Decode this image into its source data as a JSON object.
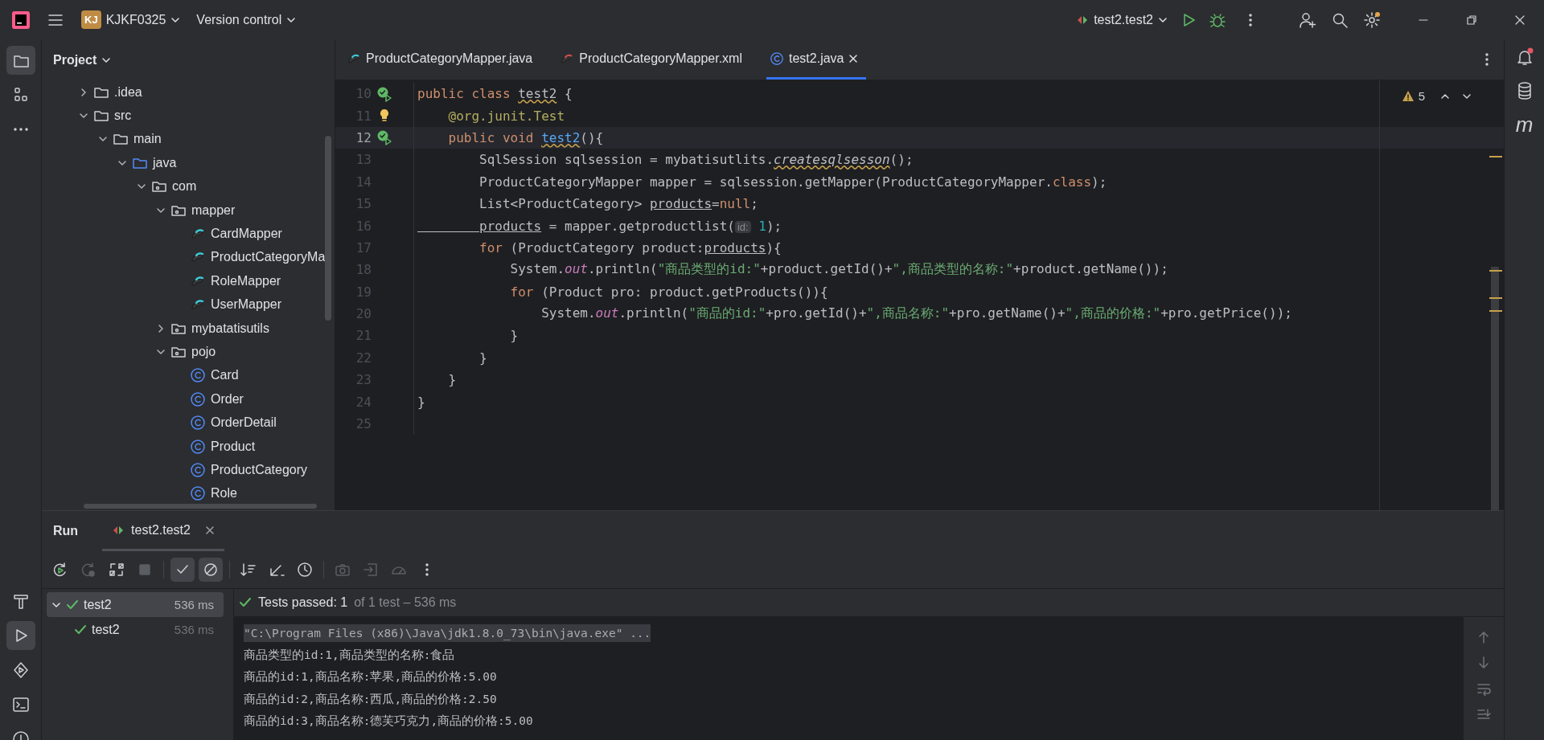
{
  "title_bar": {
    "project_badge": "KJ",
    "project": "KJKF0325",
    "vcs": "Version control",
    "run_config": "test2.test2"
  },
  "left_stripe": {
    "top": [
      {
        "kind": "folder",
        "selected": true
      },
      {
        "kind": "structure",
        "selected": false
      },
      {
        "kind": "more",
        "selected": false
      }
    ],
    "bottom": [
      {
        "kind": "build",
        "selected": false
      },
      {
        "kind": "run",
        "selected": true
      },
      {
        "kind": "services",
        "selected": false
      },
      {
        "kind": "terminal",
        "selected": false
      },
      {
        "kind": "problems",
        "selected": false
      }
    ]
  },
  "project_panel": {
    "title": "Project",
    "tree": [
      {
        "name": ".idea",
        "kind": "folder",
        "expanded": false
      },
      {
        "name": "src",
        "kind": "folder",
        "expanded": true,
        "children": [
          {
            "name": "main",
            "kind": "folder",
            "expanded": true,
            "children": [
              {
                "name": "java",
                "kind": "source",
                "expanded": true,
                "children": [
                  {
                    "name": "com",
                    "kind": "package",
                    "expanded": true,
                    "children": [
                      {
                        "name": "mapper",
                        "kind": "package",
                        "expanded": true,
                        "children": [
                          {
                            "name": "CardMapper",
                            "kind": "mapper"
                          },
                          {
                            "name": "ProductCategoryMa",
                            "kind": "mapper"
                          },
                          {
                            "name": "RoleMapper",
                            "kind": "mapper"
                          },
                          {
                            "name": "UserMapper",
                            "kind": "mapper"
                          }
                        ]
                      },
                      {
                        "name": "mybatatisutils",
                        "kind": "package",
                        "expanded": false
                      },
                      {
                        "name": "pojo",
                        "kind": "package",
                        "expanded": true,
                        "children": [
                          {
                            "name": "Card",
                            "kind": "class"
                          },
                          {
                            "name": "Order",
                            "kind": "class"
                          },
                          {
                            "name": "OrderDetail",
                            "kind": "class"
                          },
                          {
                            "name": "Product",
                            "kind": "class"
                          },
                          {
                            "name": "ProductCategory",
                            "kind": "class"
                          },
                          {
                            "name": "Role",
                            "kind": "class"
                          }
                        ]
                      }
                    ]
                  }
                ]
              }
            ]
          }
        ]
      }
    ]
  },
  "editor": {
    "tabs": [
      {
        "label": "ProductCategoryMapper.java",
        "kind": "mapper",
        "selected": false
      },
      {
        "label": "ProductCategoryMapper.xml",
        "kind": "xml",
        "selected": false
      },
      {
        "label": "test2.java",
        "kind": "class",
        "selected": true
      }
    ],
    "warnings": "5",
    "lines": [
      {
        "number": "10",
        "run_marker": true,
        "tokens": [
          {
            "t": "public class ",
            "kind": "keyword"
          },
          {
            "t": "test2",
            "kind": "plain",
            "warn": true
          },
          {
            "t": " {",
            "kind": "plain"
          }
        ]
      },
      {
        "number": "11",
        "bulb": true,
        "tokens": [
          {
            "t": "    @org.junit.Test",
            "kind": "annotation"
          }
        ]
      },
      {
        "number": "12",
        "run_marker": true,
        "current": true,
        "tokens": [
          {
            "t": "    public void ",
            "kind": "keyword"
          },
          {
            "t": "test2",
            "kind": "method",
            "warn": true
          },
          {
            "t": "(){",
            "kind": "plain"
          }
        ]
      },
      {
        "number": "13",
        "tokens": [
          {
            "t": "        SqlSession sqlsession = mybatisutlits.",
            "kind": "plain"
          },
          {
            "t": "createsqlsesson",
            "kind": "italic",
            "warn": true
          },
          {
            "t": "();",
            "kind": "plain"
          }
        ]
      },
      {
        "number": "14",
        "tokens": [
          {
            "t": "        ProductCategoryMapper mapper = sqlsession.getMapper(ProductCategoryMapper.",
            "kind": "plain"
          },
          {
            "t": "class",
            "kind": "keyword"
          },
          {
            "t": ");",
            "kind": "plain"
          }
        ]
      },
      {
        "number": "15",
        "tokens": [
          {
            "t": "        List<ProductCategory> ",
            "kind": "plain"
          },
          {
            "t": "products",
            "kind": "reassigned"
          },
          {
            "t": "=",
            "kind": "plain"
          },
          {
            "t": "null",
            "kind": "keyword"
          },
          {
            "t": ";",
            "kind": "plain"
          }
        ]
      },
      {
        "number": "16",
        "tokens": [
          {
            "t": "        products",
            "kind": "reassigned"
          },
          {
            "t": " = mapper.getproductlist(",
            "kind": "plain"
          },
          {
            "t": "id:",
            "kind": "hint"
          },
          {
            "t": " 1",
            "kind": "number"
          },
          {
            "t": ");",
            "kind": "plain"
          }
        ]
      },
      {
        "number": "17",
        "tokens": [
          {
            "t": "        for",
            "kind": "keyword"
          },
          {
            "t": " (ProductCategory product:",
            "kind": "plain"
          },
          {
            "t": "products",
            "kind": "reassigned"
          },
          {
            "t": "){",
            "kind": "plain"
          }
        ]
      },
      {
        "number": "18",
        "tokens": [
          {
            "t": "            System.",
            "kind": "plain"
          },
          {
            "t": "out",
            "kind": "static"
          },
          {
            "t": ".println(",
            "kind": "plain"
          },
          {
            "t": "\"商品类型的id:\"",
            "kind": "string"
          },
          {
            "t": "+product.getId()+",
            "kind": "plain"
          },
          {
            "t": "\",商品类型的名称:\"",
            "kind": "string"
          },
          {
            "t": "+product.getName());",
            "kind": "plain"
          }
        ]
      },
      {
        "number": "19",
        "tokens": [
          {
            "t": "            for",
            "kind": "keyword"
          },
          {
            "t": " (Product pro: product.getProducts()){",
            "kind": "plain"
          }
        ]
      },
      {
        "number": "20",
        "tokens": [
          {
            "t": "                System.",
            "kind": "plain"
          },
          {
            "t": "out",
            "kind": "static"
          },
          {
            "t": ".println(",
            "kind": "plain"
          },
          {
            "t": "\"商品的id:\"",
            "kind": "string"
          },
          {
            "t": "+pro.getId()+",
            "kind": "plain"
          },
          {
            "t": "\",商品名称:\"",
            "kind": "string"
          },
          {
            "t": "+pro.getName()+",
            "kind": "plain"
          },
          {
            "t": "\",商品的价格:\"",
            "kind": "string"
          },
          {
            "t": "+pro.getPrice());",
            "kind": "plain"
          }
        ]
      },
      {
        "number": "21",
        "tokens": [
          {
            "t": "            }",
            "kind": "plain"
          }
        ]
      },
      {
        "number": "22",
        "tokens": [
          {
            "t": "        }",
            "kind": "plain"
          }
        ]
      },
      {
        "number": "23",
        "tokens": [
          {
            "t": "    }",
            "kind": "plain"
          }
        ]
      },
      {
        "number": "24",
        "tokens": [
          {
            "t": "}",
            "kind": "plain"
          }
        ]
      },
      {
        "number": "25"
      }
    ]
  },
  "right_stripe": {
    "maven_label": "m"
  },
  "run_panel": {
    "title": "Run",
    "tabs": [
      {
        "label": "test2.test2",
        "selected": true
      }
    ],
    "toolbar": [
      {
        "kind": "rerun",
        "disabled": false
      },
      {
        "kind": "rerun-failed",
        "disabled": true
      },
      {
        "kind": "toggle-auto",
        "disabled": false
      },
      {
        "kind": "stop",
        "disabled": true
      },
      {
        "kind": "sep"
      },
      {
        "kind": "show-passed",
        "selected": true
      },
      {
        "kind": "show-ignored",
        "selected": true
      },
      {
        "kind": "sep"
      },
      {
        "kind": "sort",
        "disabled": false
      },
      {
        "kind": "collapse",
        "disabled": false
      },
      {
        "kind": "history",
        "disabled": false
      },
      {
        "kind": "sep"
      },
      {
        "kind": "camera",
        "disabled": true
      },
      {
        "kind": "import",
        "disabled": true
      },
      {
        "kind": "gauge",
        "disabled": true
      },
      {
        "kind": "more",
        "disabled": false
      }
    ],
    "tests": [
      {
        "name": "test2",
        "time": "536 ms",
        "passed": true,
        "selected": true,
        "expanded": true,
        "children": [
          {
            "name": "test2",
            "time": "536 ms",
            "passed": true,
            "selected": false
          }
        ]
      }
    ],
    "status": {
      "passed": true,
      "main": "Tests passed: 1",
      "detail": "of 1 test – 536 ms"
    },
    "console": [
      {
        "kind": "command",
        "text": "\"C:\\Program Files (x86)\\Java\\jdk1.8.0_73\\bin\\java.exe\" ..."
      },
      {
        "kind": "output",
        "text": "商品类型的id:1,商品类型的名称:食品"
      },
      {
        "kind": "output",
        "text": "商品的id:1,商品名称:苹果,商品的价格:5.00"
      },
      {
        "kind": "output",
        "text": "商品的id:2,商品名称:西瓜,商品的价格:2.50"
      },
      {
        "kind": "output",
        "text": "商品的id:3,商品名称:德芙巧克力,商品的价格:5.00"
      }
    ]
  }
}
